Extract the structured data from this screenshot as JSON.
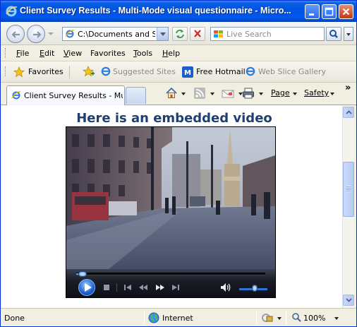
{
  "window": {
    "title": "Client Survey Results - Multi-Mode visual questionnaire - Micro..."
  },
  "address_bar": {
    "url": "C:\\Documents and Set",
    "search_placeholder": "Live Search"
  },
  "menu": {
    "items": [
      {
        "label": "File",
        "key": "F",
        "rest": "ile"
      },
      {
        "label": "Edit",
        "key": "E",
        "rest": "dit"
      },
      {
        "label": "View",
        "key": "V",
        "rest": "iew"
      },
      {
        "label": "Favorites",
        "key": "",
        "rest": "Favorites"
      },
      {
        "label": "Tools",
        "key": "T",
        "rest": "ools"
      },
      {
        "label": "Help",
        "key": "H",
        "rest": "elp"
      }
    ]
  },
  "favorites_bar": {
    "favorites_label": "Favorites",
    "suggested_sites": "Suggested Sites",
    "free_hotmail": "Free Hotmail",
    "web_slice_gallery": "Web Slice Gallery"
  },
  "tabs": {
    "active_tab_label": "Client Survey Results - Mu...",
    "page_menu": "Page",
    "safety_menu": "Safety",
    "chevron": "»"
  },
  "content": {
    "heading": "Here is an embedded video"
  },
  "video_player": {
    "seek_progress": 0.02,
    "volume_level": 0.55
  },
  "status_bar": {
    "status": "Done",
    "zone": "Internet",
    "zoom": "100%"
  },
  "colors": {
    "titlebar_blue": "#0054e3",
    "heading_color": "#1f3f6e",
    "close_button": "#c23a11"
  },
  "icons": [
    "ie-logo-icon",
    "minimize-icon",
    "maximize-icon",
    "close-icon",
    "back-arrow-icon",
    "forward-arrow-icon",
    "refresh-icon",
    "stop-icon",
    "search-icon",
    "favorites-star-icon",
    "home-icon",
    "feeds-icon",
    "mail-icon",
    "print-icon",
    "play-icon",
    "volume-icon"
  ]
}
